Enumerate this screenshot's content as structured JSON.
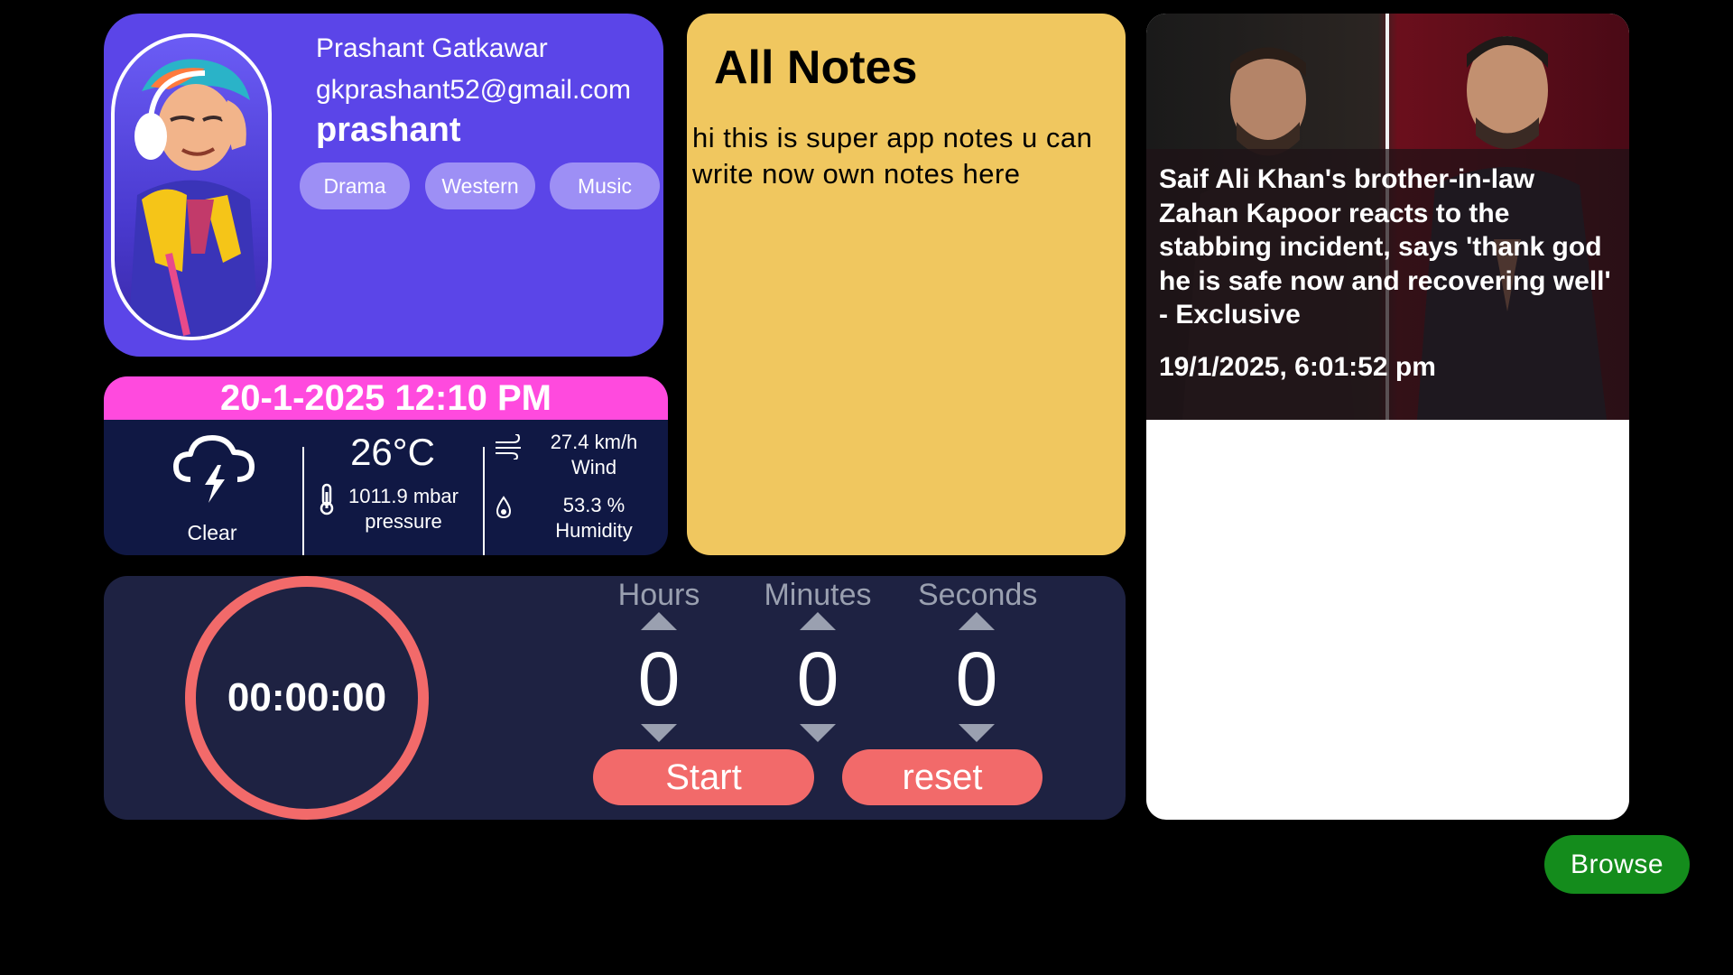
{
  "profile": {
    "name": "Prashant Gatkawar",
    "email": "gkprashant52@gmail.com",
    "username": "prashant",
    "categories": [
      "Drama",
      "Western",
      "Music"
    ]
  },
  "weather": {
    "datetime": "20-1-2025 12:10 PM",
    "condition": "Clear",
    "temperature": "26°C",
    "pressure_value": "1011.9 mbar",
    "pressure_label": "pressure",
    "wind_value": "27.4 km/h",
    "wind_label": "Wind",
    "humidity_value": "53.3 %",
    "humidity_label": "Humidity",
    "icons": [
      "thunderstorm-icon",
      "thermometer-icon",
      "wind-icon",
      "droplet-icon"
    ]
  },
  "notes": {
    "title": "All Notes",
    "content": " hi this is super app notes u can write now own notes here"
  },
  "news": {
    "headline": "Saif Ali Khan's brother-in-law Zahan Kapoor reacts to the stabbing incident, says 'thank god he is safe now and recovering well' - Exclusive",
    "date": "19/1/2025, 6:01:52 pm"
  },
  "timer": {
    "display": "00:00:00",
    "hours_label": "Hours",
    "minutes_label": "Minutes",
    "seconds_label": "Seconds",
    "hours": "0",
    "minutes": "0",
    "seconds": "0",
    "start_label": "Start",
    "reset_label": "reset"
  },
  "browse_label": "Browse",
  "colors": {
    "profile_bg": "#5b45e8",
    "chip_bg": "#9d8ff5",
    "weather_header": "#ff4ade",
    "weather_bg": "#101844",
    "notes_bg": "#f0c75f",
    "timer_bg": "#1e2242",
    "timer_accent": "#f26a6a",
    "browse_bg": "#148c1c"
  }
}
